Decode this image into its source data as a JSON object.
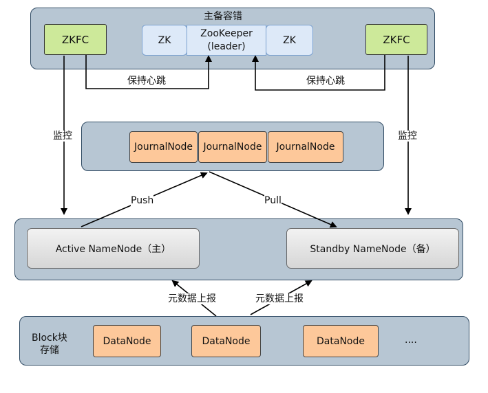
{
  "ha_panel": {
    "title": "主备容错"
  },
  "zkfc_left": "ZKFC",
  "zkfc_right": "ZKFC",
  "zk_left": "ZK",
  "zk_right": "ZK",
  "zk_leader": {
    "line1": "ZooKeeper",
    "line2": "(leader)"
  },
  "heartbeat_left": "保持心跳",
  "heartbeat_right": "保持心跳",
  "monitor_left": "监控",
  "monitor_right": "监控",
  "journal_nodes": [
    "JournalNode",
    "JournalNode",
    "JournalNode"
  ],
  "push_label": "Push",
  "pull_label": "Pull",
  "active_nn": "Active  NameNode（主）",
  "standby_nn": "Standby  NameNode（备）",
  "report_left": "元数据上报",
  "report_right": "元数据上报",
  "block_label": {
    "line1": "Block块",
    "line2": "存储"
  },
  "data_nodes": [
    "DataNode",
    "DataNode",
    "DataNode"
  ],
  "ellipsis": "....",
  "colors": {
    "panel": "#b7c6d3",
    "zkfc": "#cde99a",
    "zk": "#dde9f8",
    "orange": "#fdc89a"
  }
}
